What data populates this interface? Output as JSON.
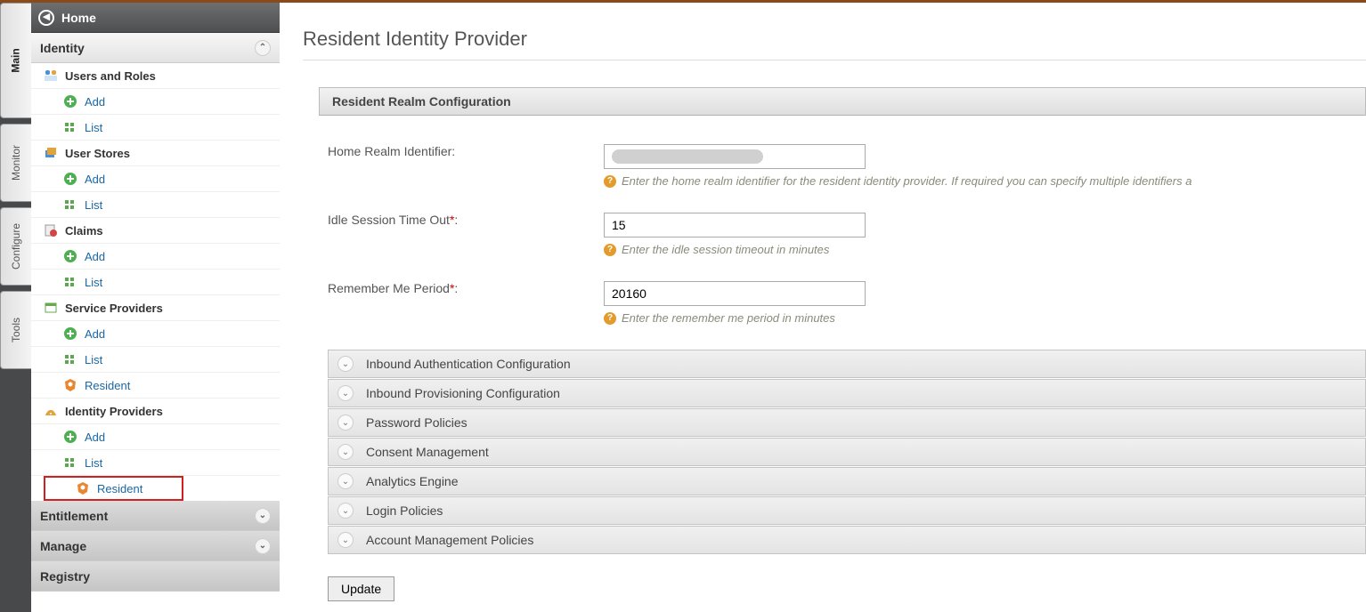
{
  "topbar": {
    "home": "Home"
  },
  "leftTabs": {
    "main": "Main",
    "monitor": "Monitor",
    "configure": "Configure",
    "tools": "Tools"
  },
  "sidebar": {
    "identity": {
      "label": "Identity",
      "usersRoles": "Users and Roles",
      "userStores": "User Stores",
      "claims": "Claims",
      "serviceProviders": "Service Providers",
      "identityProviders": "Identity Providers",
      "add": "Add",
      "list": "List",
      "resident": "Resident"
    },
    "entitlement": "Entitlement",
    "manage": "Manage",
    "registry": "Registry"
  },
  "content": {
    "title": "Resident Identity Provider",
    "realmPanel": "Resident Realm Configuration",
    "fields": {
      "home": {
        "label": "Home Realm Identifier:",
        "value": "",
        "hint": "Enter the home realm identifier for the resident identity provider. If required you can specify multiple identifiers a"
      },
      "idle": {
        "label": "Idle Session Time Out",
        "value": "15",
        "hint": "Enter the idle session timeout in minutes"
      },
      "remember": {
        "label": "Remember Me Period",
        "value": "20160",
        "hint": "Enter the remember me period in minutes"
      }
    },
    "accordions": {
      "inboundAuth": "Inbound Authentication Configuration",
      "inboundProv": "Inbound Provisioning Configuration",
      "password": "Password Policies",
      "consent": "Consent Management",
      "analytics": "Analytics Engine",
      "login": "Login Policies",
      "account": "Account Management Policies"
    },
    "update": "Update"
  }
}
